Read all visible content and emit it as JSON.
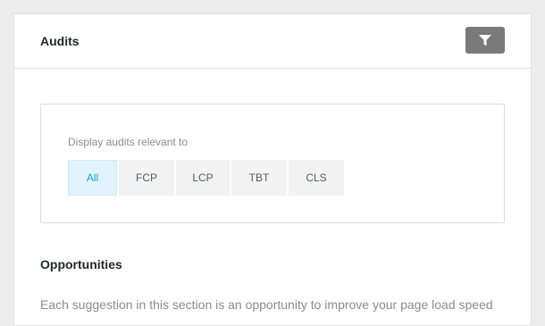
{
  "header": {
    "title": "Audits",
    "filter_icon": "filter-icon"
  },
  "filter": {
    "label": "Display audits relevant to",
    "options": [
      "All",
      "FCP",
      "LCP",
      "TBT",
      "CLS"
    ],
    "selected": "All"
  },
  "opportunities": {
    "title": "Opportunities",
    "description": "Each suggestion in this section is an opportunity to improve your page load speed"
  },
  "colors": {
    "accent": "#17a8e3",
    "active_bg": "#e1f3fc",
    "filter_button_bg": "#7a7a7a"
  }
}
